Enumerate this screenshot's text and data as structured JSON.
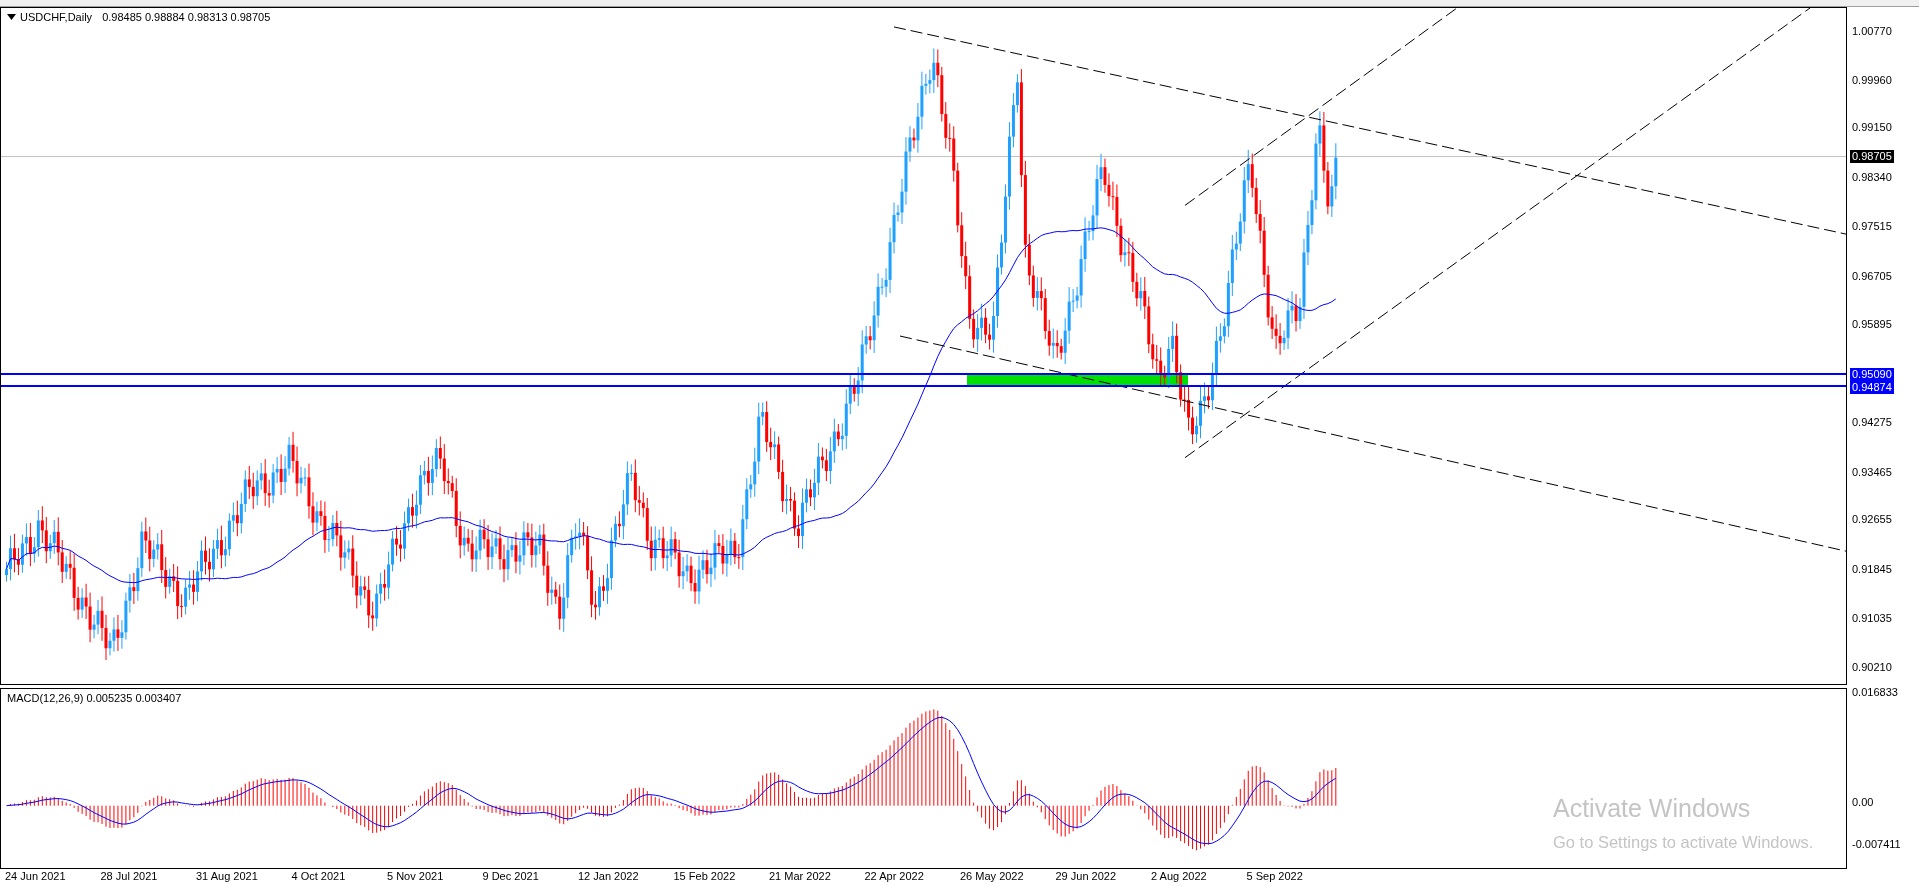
{
  "chart": {
    "symbol": "USDCHF,Daily",
    "ohlc": "0.98485 0.98884 0.98313 0.98705"
  },
  "price_axis": {
    "ticks": [
      "1.00770",
      "0.99960",
      "0.99150",
      "0.98340",
      "0.97515",
      "0.96705",
      "0.95895",
      "0.94275",
      "0.93465",
      "0.92655",
      "0.91845",
      "0.91035",
      "0.90210"
    ],
    "markers": [
      {
        "kind": "last",
        "label": "0.98705"
      },
      {
        "kind": "line",
        "label": "0.95090"
      },
      {
        "kind": "line",
        "label": "0.94874"
      }
    ]
  },
  "macd": {
    "label": "MACD(12,26,9) 0.005235 0.003407",
    "ticks": [
      "0.016833",
      "0.00",
      "-0.007411"
    ]
  },
  "time_axis": {
    "labels": [
      "24 Jun 2021",
      "28 Jul 2021",
      "31 Aug 2021",
      "4 Oct 2021",
      "5 Nov 2021",
      "9 Dec 2021",
      "12 Jan 2022",
      "15 Feb 2022",
      "21 Mar 2022",
      "22 Apr 2022",
      "26 May 2022",
      "29 Jun 2022",
      "2 Aug 2022",
      "5 Sep 2022"
    ]
  },
  "os_notice": {
    "title": "Activate Windows",
    "message": "Go to Settings to activate Windows."
  }
}
